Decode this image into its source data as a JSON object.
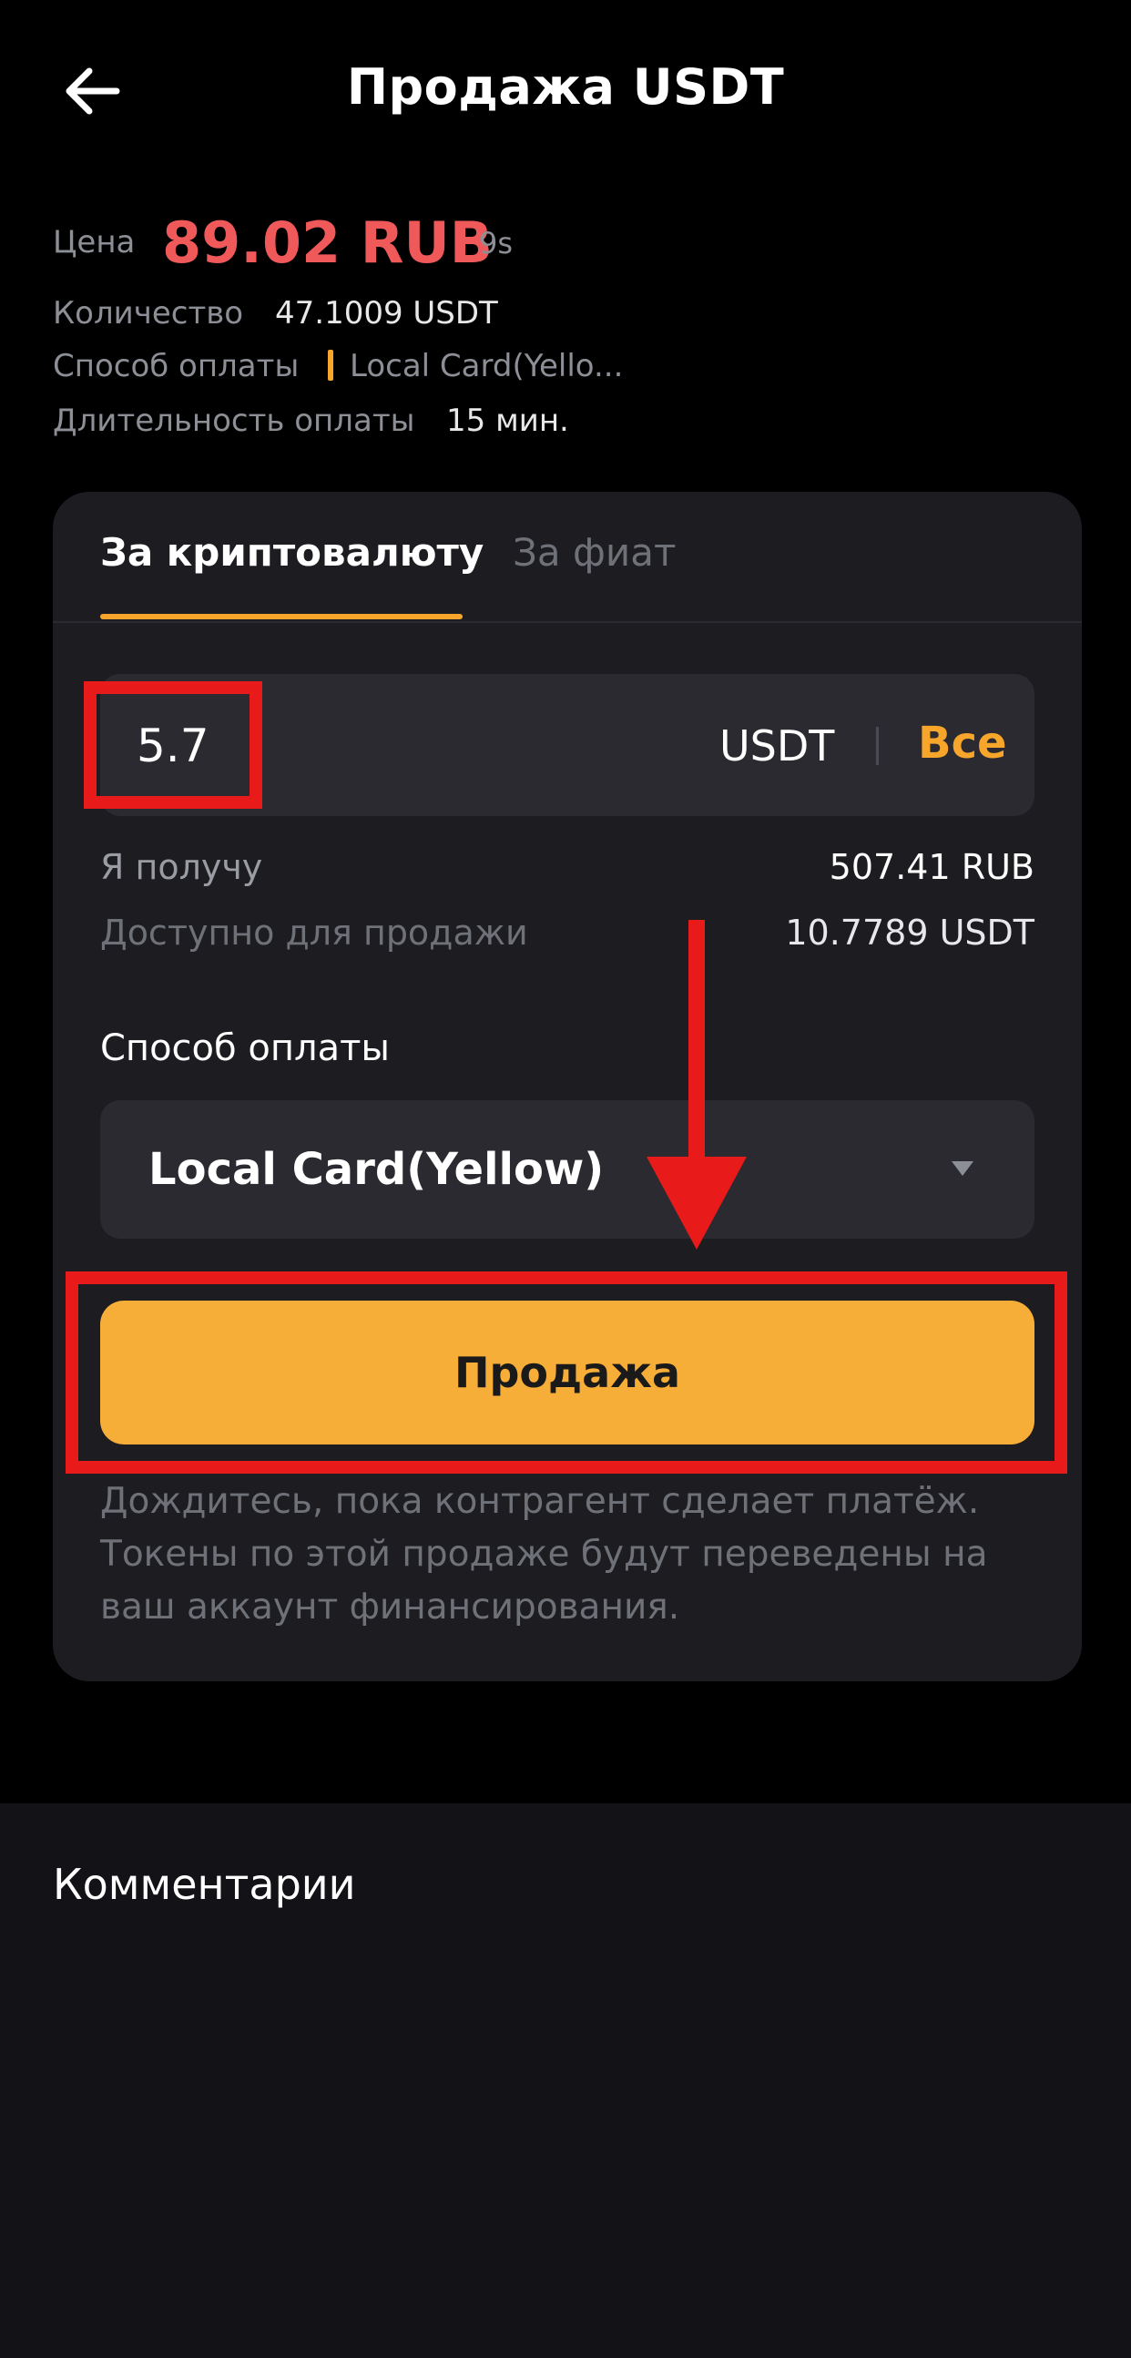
{
  "header": {
    "title": "Продажа USDT",
    "back_icon": "arrow-left-icon"
  },
  "order": {
    "price_label": "Цена",
    "price_value": "89.02 RUB",
    "timer": "9s",
    "quantity_label": "Количество",
    "quantity_value": "47.1009 USDT",
    "payment_label": "Способ оплаты",
    "payment_value": "Local Card(Yello...",
    "duration_label": "Длительность оплаты",
    "duration_value": "15 мин."
  },
  "tabs": [
    {
      "label": "За криптовалюту",
      "active": true
    },
    {
      "label": "За фиат",
      "active": false
    }
  ],
  "amount": {
    "value": "5.7",
    "currency": "USDT",
    "all_label": "Все"
  },
  "summary": {
    "receive_label": "Я получу",
    "receive_value": "507.41 RUB",
    "available_label": "Доступно для продажи",
    "available_value": "10.7789 USDT"
  },
  "payment_method": {
    "heading": "Способ оплаты",
    "selected": "Local Card(Yellow)"
  },
  "sell_button": "Продажа",
  "note": "Дождитесь, пока контрагент сделает платёж. Токены по этой продаже будут переведены на ваш аккаунт финансирования.",
  "comments": {
    "title": "Комментарии"
  },
  "colors": {
    "background": "#000000",
    "card": "#1c1c21",
    "field": "#2a2a30",
    "accent": "#f7a52b",
    "button": "#f7ae38",
    "price": "#f0595a",
    "annotation": "#e81a1a",
    "muted": "#8d8f96"
  }
}
